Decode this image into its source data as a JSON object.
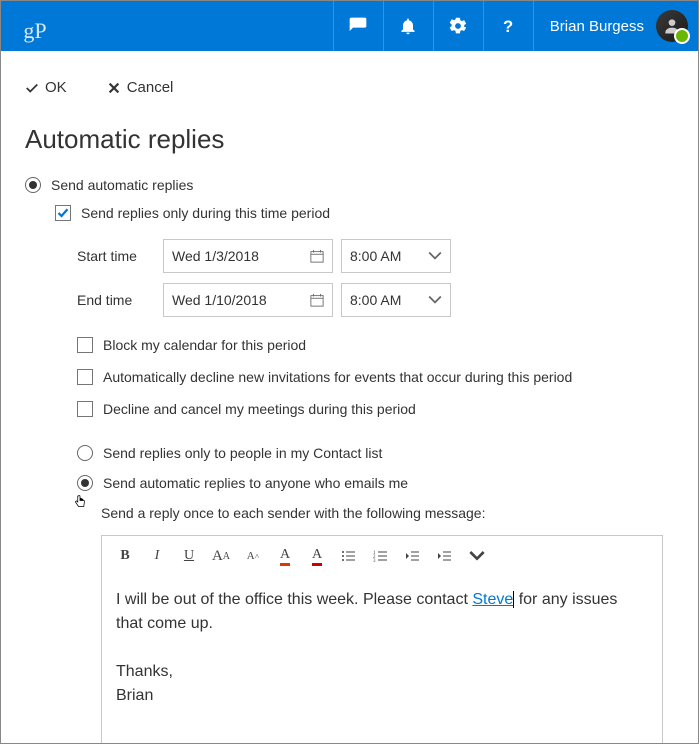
{
  "header": {
    "logo_text": "gP",
    "user_name": "Brian Burgess"
  },
  "actions": {
    "ok": "OK",
    "cancel": "Cancel"
  },
  "page": {
    "title": "Automatic replies"
  },
  "options": {
    "send_auto": "Send automatic replies",
    "time_period_check": "Send replies only during this time period",
    "start_label": "Start time",
    "end_label": "End time",
    "start_date": "Wed 1/3/2018",
    "end_date": "Wed 1/10/2018",
    "start_time": "8:00 AM",
    "end_time": "8:00 AM",
    "block_calendar": "Block my calendar for this period",
    "auto_decline": "Automatically decline new invitations for events that occur during this period",
    "decline_cancel": "Decline and cancel my meetings during this period"
  },
  "reply": {
    "contacts_only": "Send replies only to people in my Contact list",
    "anyone": "Send automatic replies to anyone who emails me",
    "desc": "Send a reply once to each sender with the following message:",
    "body_pre": "I will be out of the office this week. Please contact ",
    "body_link": "Steve",
    "body_post": " for any issues that come up.",
    "sig1": "Thanks,",
    "sig2": "Brian"
  }
}
